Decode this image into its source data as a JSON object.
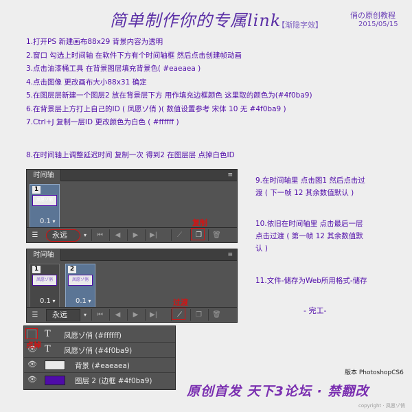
{
  "header": {
    "title": "简单制作你的专属link",
    "tag": "【渐隐字效】",
    "tutorial_name": "俏の原创教程",
    "date": "2015/05/15"
  },
  "steps": [
    "1.打开PS 新建画布88x29 背景内容为透明",
    "2.窗口 勾选上时间轴 在软件下方有个时间轴框 然后点击创建帧动画",
    "3.点击油漆桶工具 在背景图层填充背景色( #eaeaea )",
    "4.点击图像 更改画布大小88x31 确定",
    "5.在图层层新建一个图层2 放在背景层下方 用作填充边框颜色 这里取的颜色为(#4f0ba9)",
    "6.在背景层上方打上自己的ID ( 凤愿ゾ俏 )( 数值设置参考 宋体 10 无 #4f0ba9 )",
    "7.Ctrl+J 复制一层ID 更改颜色为白色 ( #ffffff )"
  ],
  "step8": "8.在时间轴上调整延迟时间 复制一次 得到2 在图层层 点掉白色ID",
  "timeline1": {
    "tab_label": "时间轴",
    "frames": [
      {
        "num": "1",
        "thumb_text": "凤愿ゾ俏",
        "delay": "0.1"
      }
    ],
    "loop": "永远",
    "annotation": "复制"
  },
  "timeline2": {
    "tab_label": "时间轴",
    "frames": [
      {
        "num": "1",
        "thumb_text": "凤愿ゾ俏",
        "delay": "0.1"
      },
      {
        "num": "2",
        "thumb_text": "凤愿ゾ俏",
        "delay": "0.1"
      }
    ],
    "loop": "永远",
    "annotation": "过渡"
  },
  "notes": {
    "n9_l1": "9.在时间轴里 点击图1 然后点击过",
    "n9_l2": "渡 ( 下一帧 12 其余数值默认 )",
    "n10_l1": "10.依旧在时间轴里 点击最后一层",
    "n10_l2": "点击过渡 ( 第一帧 12 其余数值默",
    "n10_l3": "认 )",
    "n11": "11.文件-储存为Web所用格式-储存",
    "done": "- 完工-"
  },
  "layers": {
    "annotation": "点掉",
    "rows": [
      {
        "type": "text",
        "name": "凤愿ゾ俏 (#ffffff)",
        "visible": false
      },
      {
        "type": "text",
        "name": "凤愿ゾ俏 (#4f0ba9)",
        "visible": true
      },
      {
        "type": "fill",
        "name": "背景 (#eaeaea)",
        "visible": true,
        "color": "#eaeaea"
      },
      {
        "type": "fill",
        "name": "图层 2 (边框 #4f0ba9)",
        "visible": true,
        "color": "#4f0ba9"
      }
    ]
  },
  "footer": {
    "version": "版本 PhotoshopCS6",
    "banner": "原创首发 天下3论坛 · 禁翻改",
    "copyright": "copyright · 凤愿ゾ俏"
  },
  "colors": {
    "text_purple": "#4f0ba9",
    "annotation_red": "#d21414",
    "panel_gray": "#535353"
  }
}
